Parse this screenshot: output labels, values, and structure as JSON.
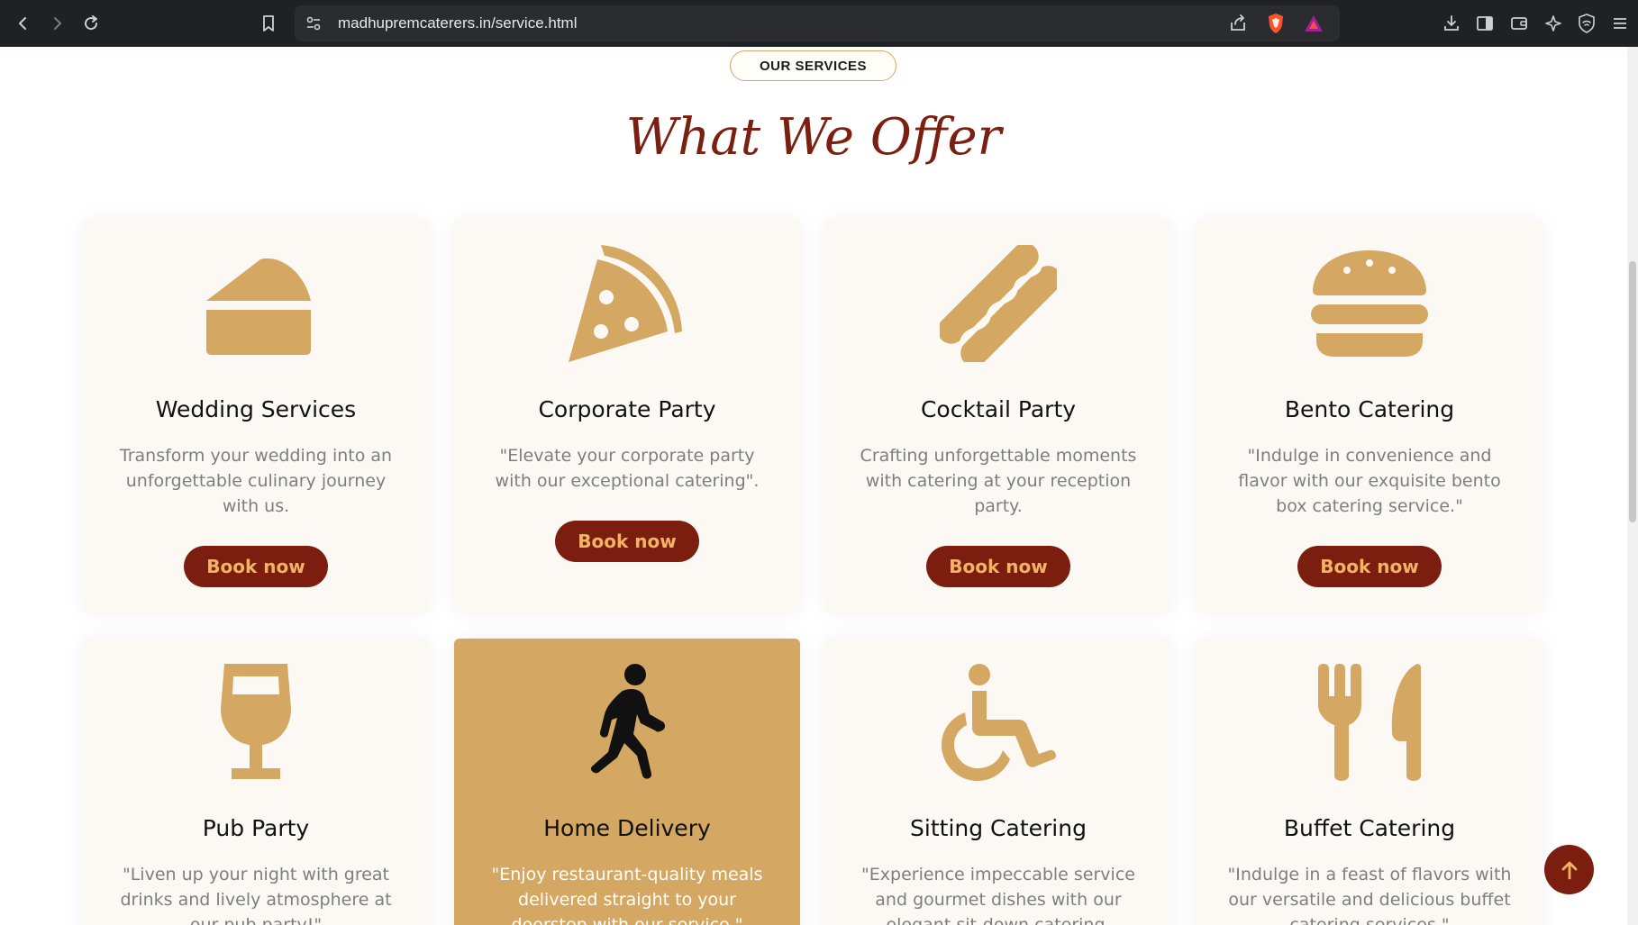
{
  "browser": {
    "url": "madhupremcaterers.in/service.html",
    "icons": [
      "back-icon",
      "forward-icon",
      "reload-icon",
      "bookmark-icon",
      "site-settings-icon",
      "share-icon",
      "brave-shield-icon",
      "brave-rewards-icon",
      "download-icon",
      "sidebar-icon",
      "wallet-icon",
      "leo-ai-icon",
      "vpn-icon",
      "menu-icon"
    ]
  },
  "section": {
    "badge": "OUR SERVICES",
    "heading": "What We Offer"
  },
  "colors": {
    "accent": "#d4a762",
    "brand_dark": "#7b1e0f",
    "button_text": "#f0b463",
    "card_bg": "#fcf9f5",
    "heading": "#7b2010"
  },
  "services": [
    {
      "icon": "cake-icon",
      "title": "Wedding Services",
      "description": "Transform your wedding into an unforgettable culinary journey with us.",
      "button": "Book now"
    },
    {
      "icon": "pizza-slice-icon",
      "title": "Corporate Party",
      "description": "\"Elevate your corporate party with our exceptional catering\".",
      "button": "Book now"
    },
    {
      "icon": "hotdog-icon",
      "title": "Cocktail Party",
      "description": "Crafting unforgettable moments with catering at your reception party.",
      "button": "Book now"
    },
    {
      "icon": "burger-icon",
      "title": "Bento Catering",
      "description": "\"Indulge in convenience and flavor with our exquisite bento box catering service.\"",
      "button": "Book now"
    },
    {
      "icon": "wine-glass-icon",
      "title": "Pub Party",
      "description": "\"Liven up your night with great drinks and lively atmosphere at our pub party!\""
    },
    {
      "icon": "person-walking-icon",
      "title": "Home Delivery",
      "description": "\"Enjoy restaurant-quality meals delivered straight to your doorstep with our service.\"",
      "active": true
    },
    {
      "icon": "wheelchair-icon",
      "title": "Sitting Catering",
      "description": "\"Experience impeccable service and gourmet dishes with our elegant sit-down catering."
    },
    {
      "icon": "fork-knife-icon",
      "title": "Buffet Catering",
      "description": "\"Indulge in a feast of flavors with our versatile and delicious buffet catering services.\""
    }
  ],
  "back_to_top": {
    "icon": "arrow-up-icon"
  }
}
